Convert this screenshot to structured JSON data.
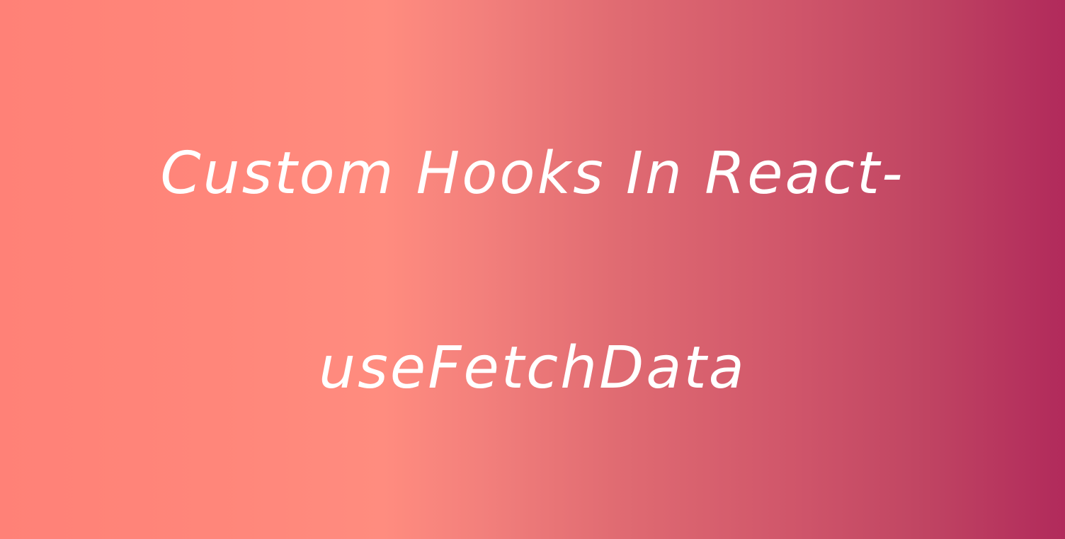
{
  "title": {
    "line1": "Custom Hooks In React-",
    "line2": "useFetchData"
  },
  "colors": {
    "gradient_start": "#ff8177",
    "gradient_mid": "#ff8c7f",
    "gradient_end": "#b12a5b",
    "text": "#ffffff"
  }
}
